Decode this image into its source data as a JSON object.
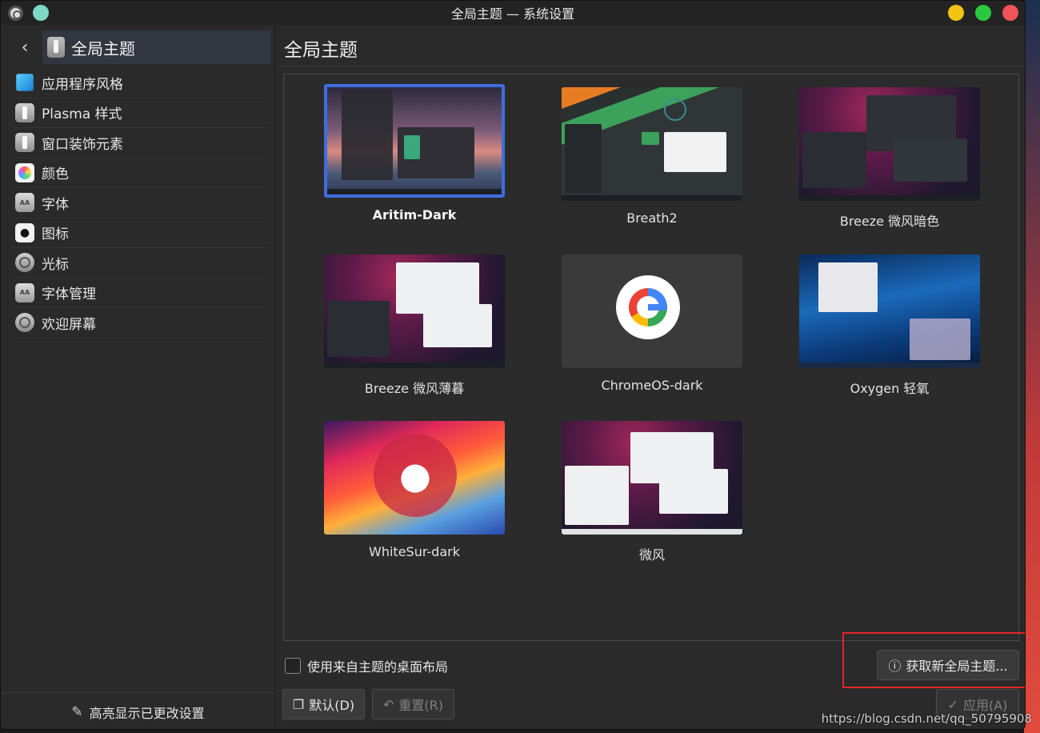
{
  "window": {
    "title": "全局主题 — 系统设置"
  },
  "sidebar": {
    "header": "全局主题",
    "items": [
      {
        "label": "应用程序风格",
        "icon": "cube-icon"
      },
      {
        "label": "Plasma 样式",
        "icon": "plasma-icon"
      },
      {
        "label": "窗口装饰元素",
        "icon": "window-deco-icon"
      },
      {
        "label": "颜色",
        "icon": "color-wheel-icon"
      },
      {
        "label": "字体",
        "icon": "font-icon"
      },
      {
        "label": "图标",
        "icon": "apple-icon"
      },
      {
        "label": "光标",
        "icon": "cursor-icon"
      },
      {
        "label": "字体管理",
        "icon": "font-manager-icon"
      },
      {
        "label": "欢迎屏幕",
        "icon": "splash-icon"
      }
    ],
    "footer": "高亮显示已更改设置"
  },
  "main": {
    "title": "全局主题",
    "themes": [
      {
        "name": "Aritim-Dark",
        "selected": true
      },
      {
        "name": "Breath2",
        "selected": false
      },
      {
        "name": "Breeze 微风暗色",
        "selected": false
      },
      {
        "name": "Breeze 微风薄暮",
        "selected": false
      },
      {
        "name": "ChromeOS-dark",
        "selected": false
      },
      {
        "name": "Oxygen 轻氧",
        "selected": false
      },
      {
        "name": "WhiteSur-dark",
        "selected": false
      },
      {
        "name": "微风",
        "selected": false
      }
    ],
    "use_layout_checkbox": {
      "label": "使用来自主题的桌面布局",
      "checked": false
    },
    "get_new_button": "获取新全局主题...",
    "default_button": "默认(D)",
    "reset_button": "重置(R)",
    "apply_button": "应用(A)"
  },
  "watermark": "https://blog.csdn.net/qq_50795908",
  "colors": {
    "selection_border": "#3d6ee0",
    "highlight_box": "#e0262a",
    "minimize": "#f3c314",
    "maximize": "#28c940",
    "close": "#f05458"
  }
}
